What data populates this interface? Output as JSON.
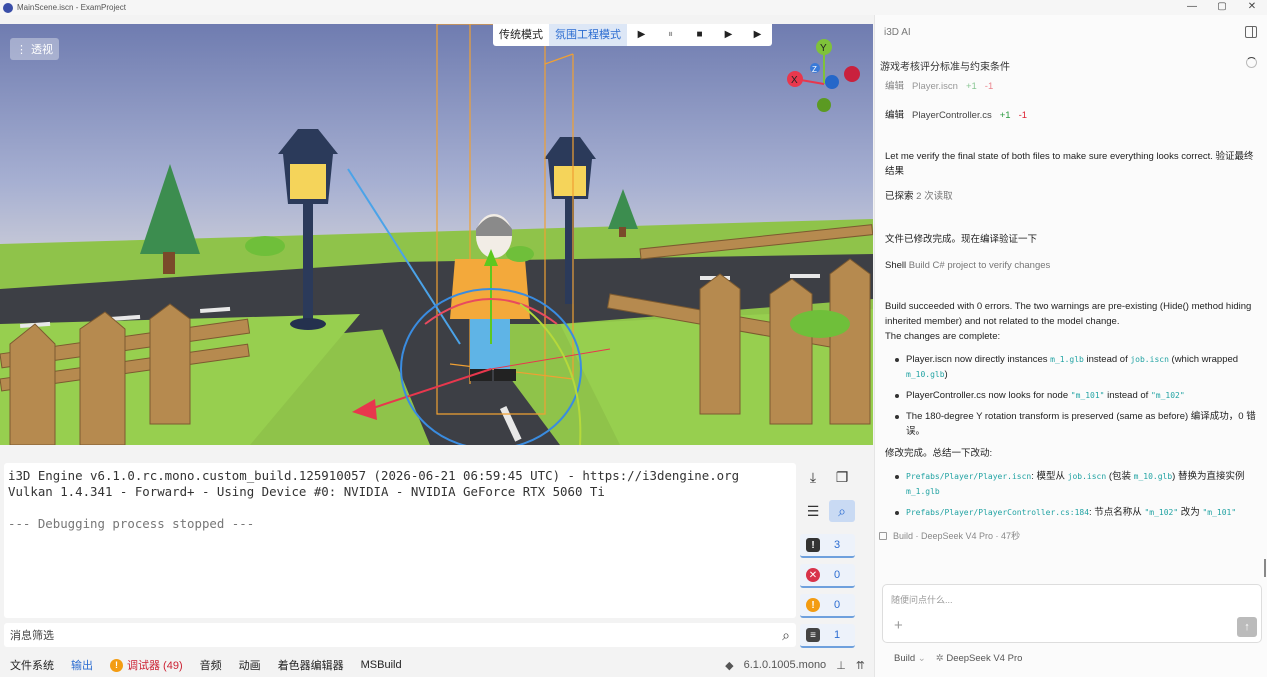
{
  "window": {
    "title": "MainScene.iscn - ExamProject",
    "controls": [
      "—",
      "▢",
      "✕"
    ]
  },
  "viewport": {
    "view_label": "透视",
    "modes": [
      "传统模式",
      "氛围工程模式"
    ],
    "active_mode": "氛围工程模式",
    "gizmo_axes": {
      "y": "Y",
      "x": "X",
      "z": "Z"
    }
  },
  "console": {
    "lines": [
      "i3D Engine v6.1.0.rc.mono.custom_build.125910057 (2026-06-21 06:59:45 UTC) - https://i3dengine.org",
      "Vulkan 1.4.341 - Forward+ - Using Device #0: NVIDIA - NVIDIA GeForce RTX 5060 Ti"
    ],
    "stopped_line": "--- Debugging process stopped ---",
    "filter_placeholder": "消息筛选",
    "counts": {
      "messages": "3",
      "errors": "0",
      "warnings": "0",
      "logs": "1"
    }
  },
  "bottom_tabs": {
    "filesystem": "文件系统",
    "output": "输出",
    "debugger": "调试器 (49)",
    "audio": "音频",
    "animation": "动画",
    "shader_editor": "着色器编辑器",
    "msbuild": "MSBuild",
    "version": "6.1.0.1005.mono"
  },
  "ai": {
    "title": "i3D AI",
    "task": "游戏考核评分标准与约束条件",
    "edit1": {
      "verb": "编辑",
      "file": "Player.iscn",
      "plus": "+1",
      "minus": "-1"
    },
    "edit2": {
      "verb": "编辑",
      "file": "PlayerController.cs",
      "plus": "+1",
      "minus": "-1"
    },
    "verify": "Let me verify the final state of both files to make sure everything looks correct. 验证最终结果",
    "explored_label": "已探索",
    "explored_value": "2 次读取",
    "modified": "文件已修改完成。现在编译验证一下",
    "shell_label": "Shell",
    "shell_value": "Build C# project to verify changes",
    "build_msg_1": "Build succeeded with 0 errors. The two warnings are pre-existing (Hide() method hiding inherited member) and not related to the model change.",
    "build_msg_2": "The changes are complete:",
    "change1_a": "Player.iscn now directly instances ",
    "change1_code1": "m_1.glb",
    "change1_b": " instead of ",
    "change1_code2": "job.iscn",
    "change1_c": " (which wrapped ",
    "change1_code3": "m_10.glb",
    "change1_d": ")",
    "change2_a": "PlayerController.cs now looks for node ",
    "change2_code1": "\"m_101\"",
    "change2_b": " instead of ",
    "change2_code2": "\"m_102\"",
    "change3": "The 180-degree Y rotation transform is preserved (same as before) 编译成功，0 错误。",
    "summary": "修改完成。总结一下改动:",
    "sum1_code1": "Prefabs/Player/Player.iscn",
    "sum1_a": ": 模型从 ",
    "sum1_code2": "job.iscn",
    "sum1_b": " (包装 ",
    "sum1_code3": "m_10.glb",
    "sum1_c": ") 替换为直接实例 ",
    "sum1_code4": "m_1.glb",
    "sum2_code1": "Prefabs/Player/PlayerController.cs:184",
    "sum2_a": ": 节点名称从 ",
    "sum2_code2": "\"m_102\"",
    "sum2_b": " 改为 ",
    "sum2_code3": "\"m_101\"",
    "meta": "Build · DeepSeek V4 Pro · 47秒",
    "input_placeholder": "随便问点什么...",
    "mode": "Build",
    "model": "DeepSeek V4 Pro"
  }
}
